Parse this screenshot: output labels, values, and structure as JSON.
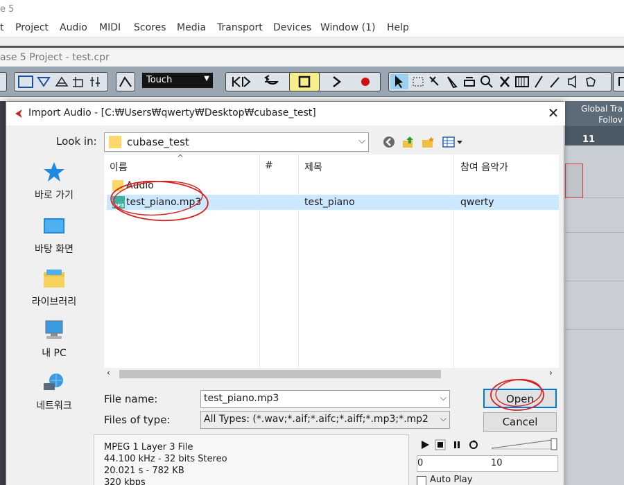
{
  "app": {
    "title": "e 5",
    "project_title": "ase 5 Project - test.cpr"
  },
  "menu": [
    "t",
    "Project",
    "Audio",
    "MIDI",
    "Scores",
    "Media",
    "Transport",
    "Devices",
    "Window (1)",
    "Help"
  ],
  "toolbar": {
    "automation_mode": "Touch"
  },
  "project": {
    "global_track_line1": "Global Tra",
    "global_track_line2": "Follov",
    "ruler_bar": "11"
  },
  "dialog": {
    "title": "Import Audio - [C:₩Users₩qwerty₩Desktop₩cubase_test]",
    "look_in_label": "Look in:",
    "look_in_value": "cubase_test",
    "places": [
      {
        "label": "바로 가기",
        "icon": "quick-access-star-icon"
      },
      {
        "label": "바탕 화면",
        "icon": "desktop-icon"
      },
      {
        "label": "라이브러리",
        "icon": "library-icon"
      },
      {
        "label": "내 PC",
        "icon": "this-pc-icon"
      },
      {
        "label": "네트워크",
        "icon": "network-icon"
      }
    ],
    "columns": [
      "이름",
      "#",
      "제목",
      "참여 음악가"
    ],
    "rows": [
      {
        "name": "Audio",
        "number": "",
        "title": "",
        "artist": "",
        "type": "folder"
      },
      {
        "name": "test_piano.mp3",
        "number": "",
        "title": "test_piano",
        "artist": "qwerty",
        "type": "mp3",
        "selected": true
      }
    ],
    "file_name_label": "File name:",
    "file_name_value": "test_piano.mp3",
    "files_of_type_label": "Files of type:",
    "files_of_type_value": "All Types: (*.wav;*.aif;*.aifc;*.aiff;*.mp3;*.mp2",
    "open_button": "Open",
    "cancel_button": "Cancel",
    "info": {
      "format": "MPEG 1 Layer 3 File",
      "specs": "44.100 kHz - 32 bits Stereo",
      "duration_size": "20.021 s - 782 KB",
      "bitrate": "320 kbps"
    },
    "preview": {
      "position_start": "0",
      "position_end": "10",
      "auto_play_label": "Auto Play",
      "auto_play_checked": false
    }
  },
  "colors": {
    "toolbar_bg": "#9aa6b2",
    "selection": "#cce8ff",
    "accent": "#0078d7",
    "annotation": "#d42020"
  }
}
